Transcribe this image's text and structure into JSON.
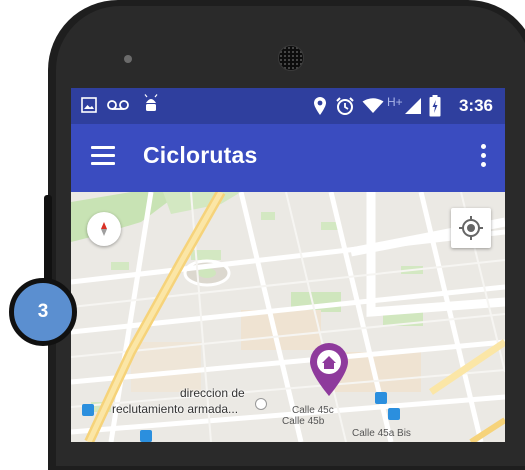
{
  "status_bar": {
    "left_icons": [
      "image-icon",
      "voicemail-icon",
      "android-icon"
    ],
    "right_icons": [
      "location-icon",
      "alarm-icon",
      "wifi-icon",
      "signal-icon",
      "battery-charging-icon"
    ],
    "network_type": "H+",
    "time": "3:36"
  },
  "app_bar": {
    "title": "Ciclorutas",
    "menu_icon": "hamburger-menu-icon",
    "overflow_icon": "more-vert-icon"
  },
  "map": {
    "labels": {
      "poi_line1": "direccion de",
      "poi_line2": "reclutamiento armada...",
      "street1": "Calle 45c",
      "street2": "Calle 45b",
      "street3": "Calle 45a Bis"
    },
    "marker_icon": "home-marker-icon",
    "marker_color": "#8e3a9c",
    "compass_icon": "compass-icon",
    "locate_icon": "my-location-icon"
  },
  "callout": {
    "number": "3"
  },
  "colors": {
    "status_bar": "#2f3f9e",
    "app_bar": "#3a4cc0",
    "badge": "#5b8fd0"
  }
}
